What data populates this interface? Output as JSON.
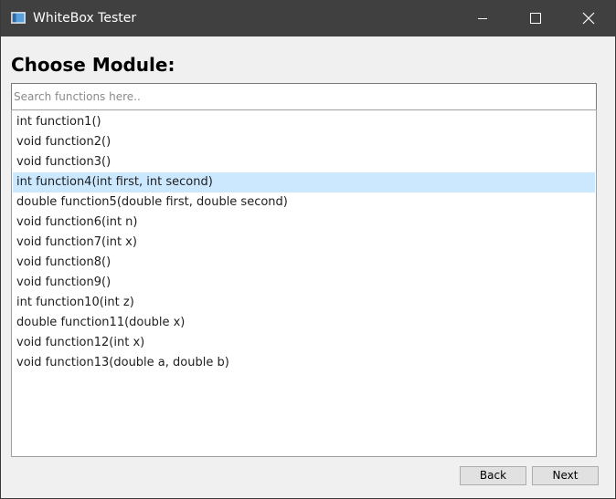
{
  "window": {
    "title": "WhiteBox Tester",
    "titlebar_color": "#404040",
    "background_color": "#f0f0f0"
  },
  "main": {
    "heading": "Choose Module:",
    "search_placeholder": "Search functions here..",
    "search_value": "",
    "functions": [
      "int function1()",
      "void function2()",
      "void function3()",
      "int function4(int first, int second)",
      "double function5(double first, double second)",
      "void function6(int n)",
      "void function7(int x)",
      "void function8()",
      "void function9()",
      "int function10(int z)",
      "double function11(double x)",
      "void function12(int x)",
      "void function13(double a, double b)"
    ],
    "selected_index": 3,
    "selection_color": "#cce8ff"
  },
  "footer": {
    "back_label": "Back",
    "next_label": "Next"
  },
  "icons": {
    "app": "app-window-icon",
    "minimize": "minimize-icon",
    "maximize": "maximize-icon",
    "close": "close-icon"
  }
}
